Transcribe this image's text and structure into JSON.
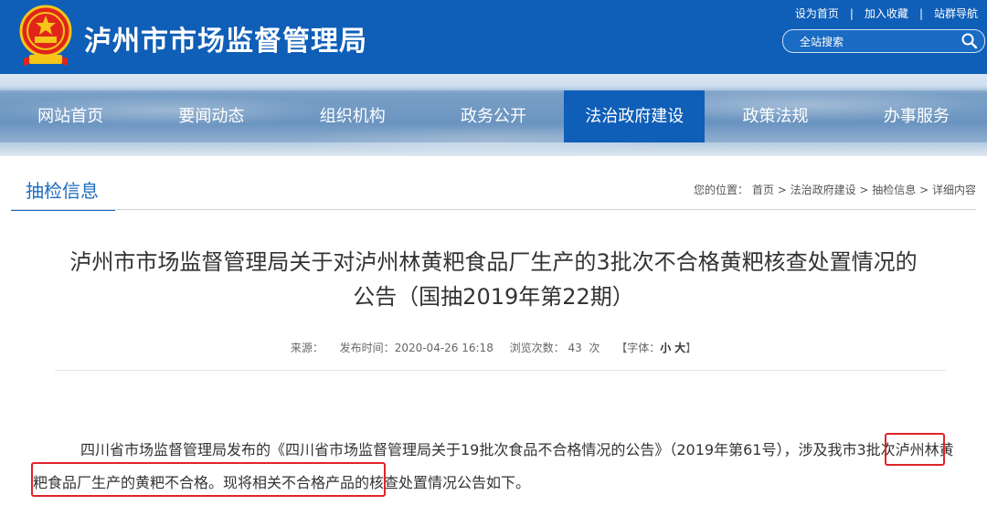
{
  "header": {
    "site_title": "泸州市市场监督管理局",
    "top_links": [
      "设为首页",
      "加入收藏",
      "站群导航"
    ],
    "search_placeholder": "全站搜索"
  },
  "nav": {
    "items": [
      "网站首页",
      "要闻动态",
      "组织机构",
      "政务公开",
      "法治政府建设",
      "政策法规",
      "办事服务"
    ],
    "active": "法治政府建设"
  },
  "section": {
    "tab": "抽检信息",
    "breadcrumb_prefix": "您的位置：",
    "breadcrumb": [
      "首页",
      "法治政府建设",
      "抽检信息",
      "详细内容"
    ]
  },
  "article": {
    "title_line1": "泸州市市场监督管理局关于对泸州林黄粑食品厂生产的3批次不合格黄粑核查处置情况的",
    "title_line2": "公告（国抽2019年第22期）",
    "meta": {
      "source_label": "来源：",
      "publish_label": "发布时间：",
      "publish_time": "2020-04-26 16:18",
      "views_label": "浏览次数：",
      "views": "43",
      "views_unit": "次",
      "font_prefix": "【字体：",
      "font_small": "小",
      "font_large": "大",
      "font_suffix": "】"
    },
    "paragraph_part1": "四川省市场监督管理局发布的《四川省市场监督管理局关于19批次食品不合格情况的公告》（2019年第61号），",
    "paragraph_part2": "涉及我",
    "paragraph_part3": "市3批次泸州林黄粑食品厂生产的黄粑不合格。",
    "paragraph_part4": "现将相关不合格产品的核查处置情况公告如下。"
  },
  "colors": {
    "header_blue": "#0f5eb7",
    "highlight_red": "#e0242b",
    "section_blue": "#1f6dbf"
  }
}
